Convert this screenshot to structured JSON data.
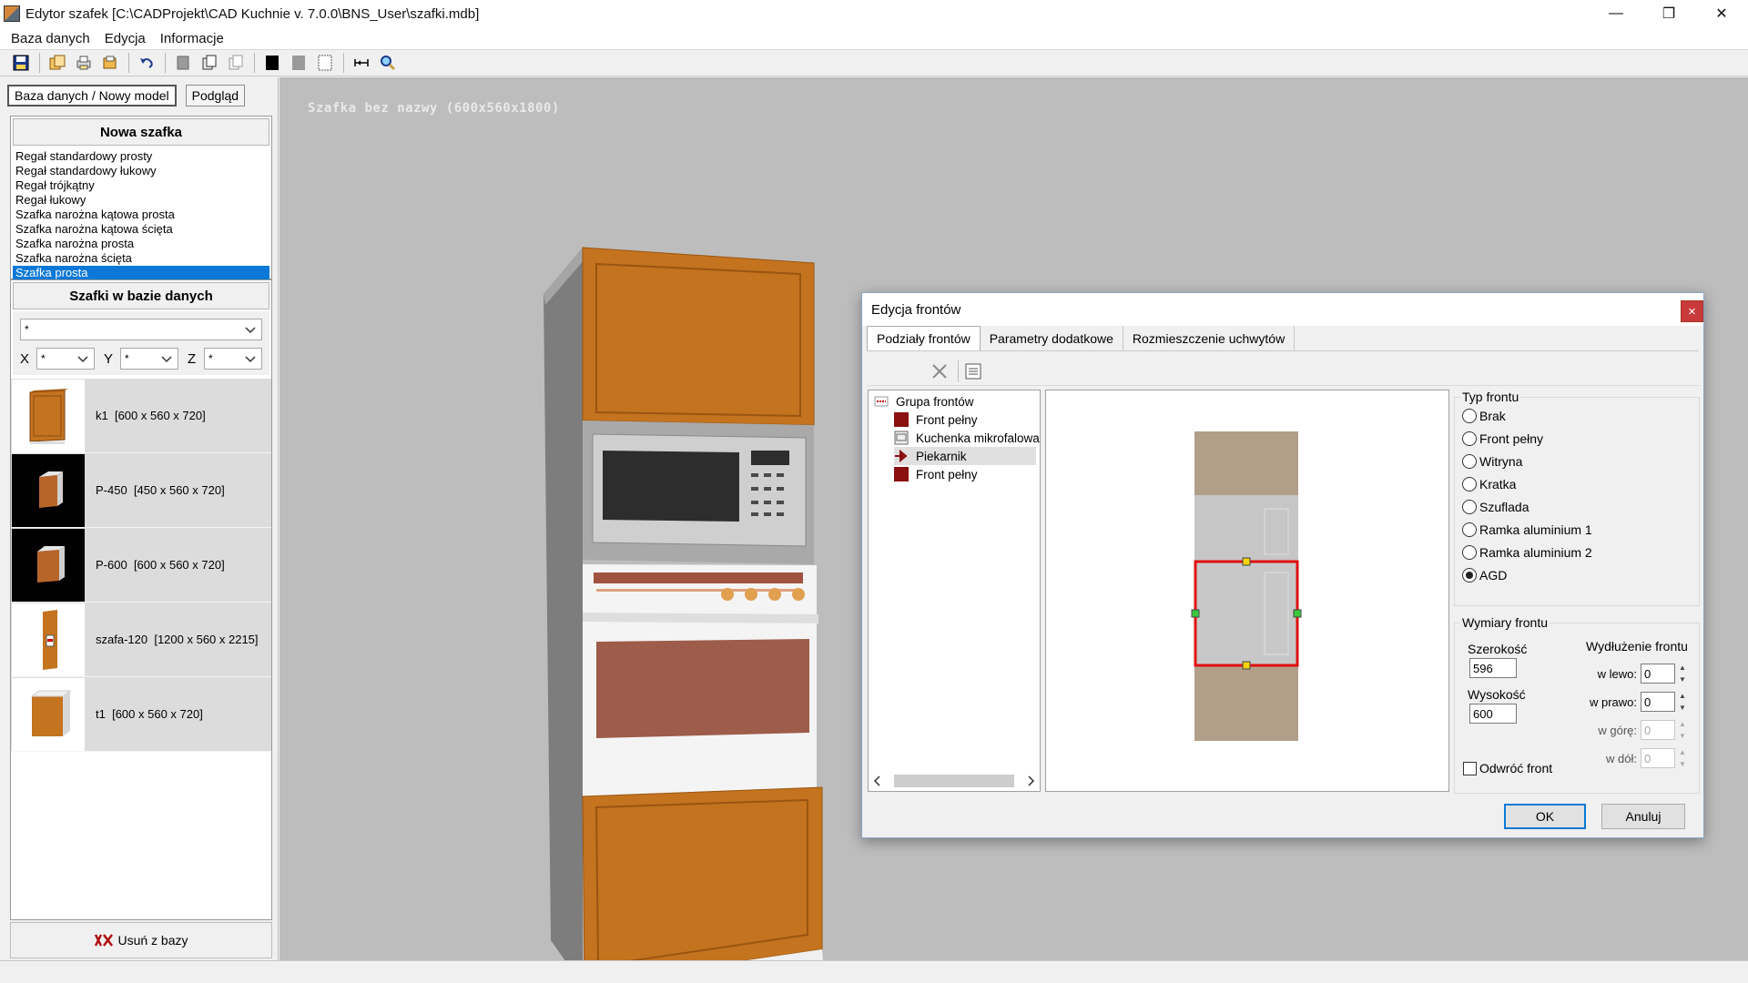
{
  "window": {
    "title": "Edytor szafek [C:\\CADProjekt\\CAD Kuchnie v. 7.0.0\\BNS_User\\szafki.mdb]",
    "minimize": "—",
    "restore": "❐",
    "close": "✕"
  },
  "menu": [
    "Baza danych",
    "Edycja",
    "Informacje"
  ],
  "left": {
    "tabs": [
      "Baza danych / Nowy model",
      "Podgląd"
    ],
    "new_header": "Nowa szafka",
    "types": [
      "Regał standardowy prosty",
      "Regał standardowy łukowy",
      "Regał trójkątny",
      "Regał łukowy",
      "Szafka narożna kątowa prosta",
      "Szafka narożna kątowa ścięta",
      "Szafka narożna prosta",
      "Szafka narożna ścięta",
      "Szafka prosta"
    ],
    "db_header": "Szafki w bazie danych",
    "filter_value": "*",
    "x_label": "X",
    "x_value": "*",
    "y_label": "Y",
    "y_value": "*",
    "z_label": "Z",
    "z_value": "*",
    "cabinets": [
      {
        "name": "k1",
        "dims": "[600 x 560 x 720]"
      },
      {
        "name": "P-450",
        "dims": "[450 x 560 x 720]"
      },
      {
        "name": "P-600",
        "dims": "[600 x 560 x 720]"
      },
      {
        "name": "szafa-120",
        "dims": "[1200 x 560 x 2215]"
      },
      {
        "name": "t1",
        "dims": "[600 x 560 x 720]"
      }
    ],
    "remove_label": "Usuń z bazy"
  },
  "viewport": {
    "caption": "Szafka bez nazwy (600x560x1800)"
  },
  "dialog": {
    "title": "Edycja frontów",
    "close": "×",
    "tabs": [
      "Podziały frontów",
      "Parametry dodatkowe",
      "Rozmieszczenie uchwytów"
    ],
    "tree": {
      "root": "Grupa frontów",
      "items": [
        "Front pełny",
        "Kuchenka mikrofalowa",
        "Piekarnik",
        "Front pełny"
      ]
    },
    "type_group": "Typ frontu",
    "types": [
      "Brak",
      "Front pełny",
      "Witryna",
      "Kratka",
      "Szuflada",
      "Ramka aluminium 1",
      "Ramka aluminium 2",
      "AGD"
    ],
    "selected_type": "AGD",
    "dims_group": "Wymiary frontu",
    "width_label": "Szerokość",
    "width_value": "596",
    "height_label": "Wysokość",
    "height_value": "600",
    "ext_label": "Wydłużenie frontu",
    "left_label": "w lewo:",
    "left_value": "0",
    "right_label": "w prawo:",
    "right_value": "0",
    "up_label": "w górę:",
    "up_value": "0",
    "down_label": "w dół:",
    "down_value": "0",
    "flip_label": "Odwróć front",
    "ok": "OK",
    "cancel": "Anuluj"
  },
  "colors": {
    "selection": "#0a78d7",
    "front_dark": "#8b1010",
    "highlight_frame": "#e01010",
    "wood": "#c4731f",
    "viewport_bg": "#bdbdbd"
  }
}
